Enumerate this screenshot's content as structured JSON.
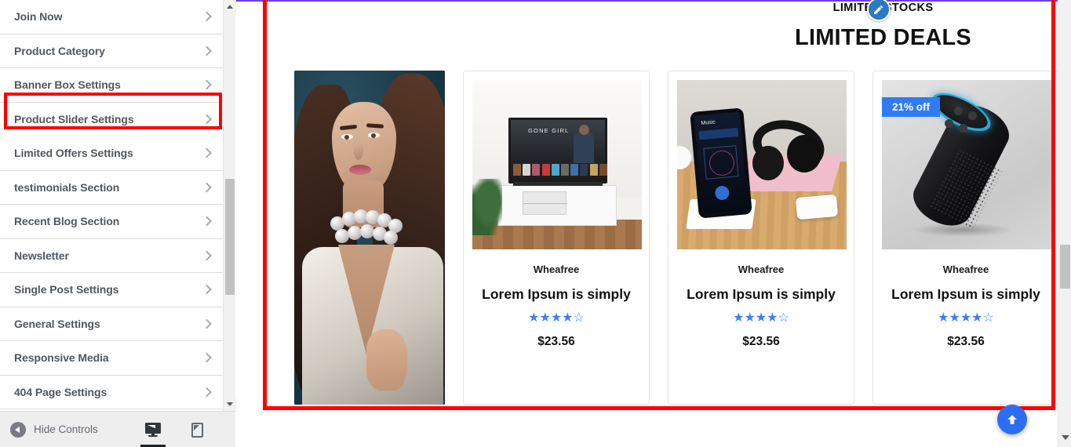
{
  "sidebar": {
    "items": [
      {
        "label": "Join Now",
        "highlighted": false
      },
      {
        "label": "Product Category",
        "highlighted": false
      },
      {
        "label": "Banner Box Settings",
        "highlighted": false
      },
      {
        "label": "Product Slider Settings",
        "highlighted": true
      },
      {
        "label": "Limited Offers Settings",
        "highlighted": false
      },
      {
        "label": "testimonials Section",
        "highlighted": false
      },
      {
        "label": "Recent Blog Section",
        "highlighted": false
      },
      {
        "label": "Newsletter",
        "highlighted": false
      },
      {
        "label": "Single Post Settings",
        "highlighted": false
      },
      {
        "label": "General Settings",
        "highlighted": false
      },
      {
        "label": "Responsive Media",
        "highlighted": false
      },
      {
        "label": "404 Page Settings",
        "highlighted": false
      }
    ],
    "footer": {
      "hide_controls_label": "Hide Controls",
      "devices": [
        {
          "name": "desktop",
          "active": true
        },
        {
          "name": "tablet",
          "active": false
        },
        {
          "name": "mobile",
          "active": false
        }
      ]
    }
  },
  "preview": {
    "section": {
      "subtitle": "LIMITED STOCKS",
      "title": "LIMITED DEALS",
      "edit_icon": "pencil-icon"
    },
    "products": [
      {
        "type": "hero",
        "image": "woman-portrait-pearl-necklace"
      },
      {
        "type": "card",
        "image": "tv-on-white-console-gone-girl",
        "badge": null,
        "vendor": "Wheafree",
        "name": "Lorem Ipsum is simply",
        "rating_filled": 4,
        "rating_total": 5,
        "price": "$23.56"
      },
      {
        "type": "card",
        "image": "phone-headphones-earbuds-desk",
        "badge": null,
        "vendor": "Wheafree",
        "name": "Lorem Ipsum is simply",
        "rating_filled": 4,
        "rating_total": 5,
        "price": "$23.56"
      },
      {
        "type": "card",
        "image": "black-smart-speaker-cyan-ring",
        "badge": "21% off",
        "vendor": "Wheafree",
        "name": "Lorem Ipsum is simply",
        "rating_filled": 4,
        "rating_total": 5,
        "price": "$23.56"
      }
    ],
    "scroll_top_icon": "arrow-up-icon"
  },
  "colors": {
    "annotation": "#fe0000",
    "accent_blue": "#2d6df6",
    "badge_blue": "#2f7bf6",
    "star_blue": "#3f7ef5",
    "edit_blue": "#2a79c3",
    "sidebar_text": "#50575e",
    "top_accent": "#6b3fe8"
  }
}
